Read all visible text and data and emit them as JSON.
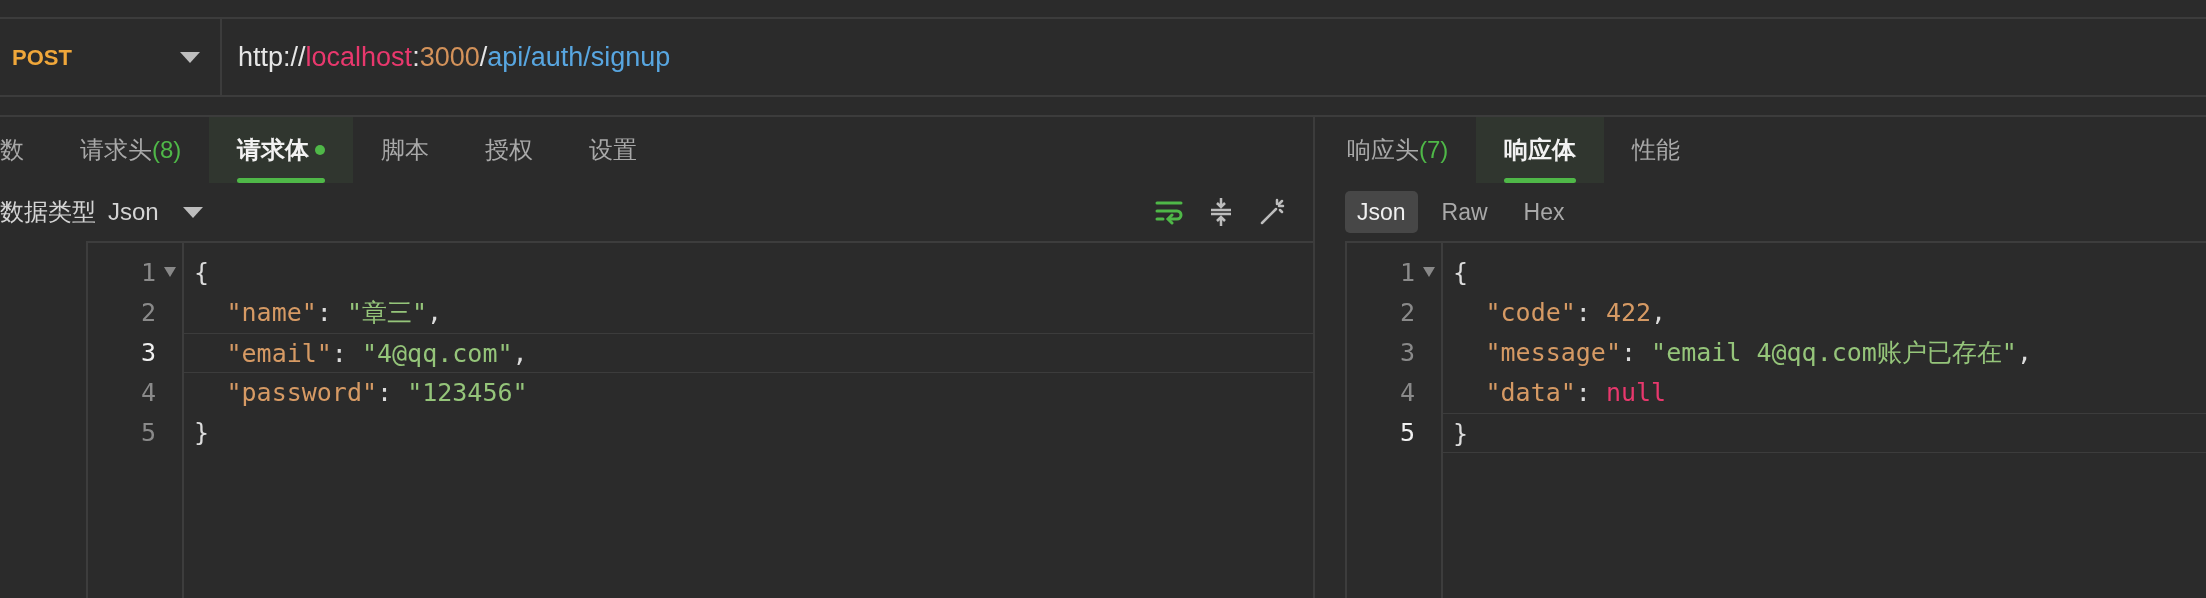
{
  "request": {
    "method": "POST",
    "url": [
      {
        "kind": "scheme",
        "text": "http://"
      },
      {
        "kind": "host",
        "text": "localhost"
      },
      {
        "kind": "punct",
        "text": ":"
      },
      {
        "kind": "port",
        "text": "3000"
      },
      {
        "kind": "punct",
        "text": "/"
      },
      {
        "kind": "path",
        "text": "api/auth/signup"
      }
    ]
  },
  "request_tabs": [
    {
      "label": "数",
      "selected": false
    },
    {
      "label": "请求头",
      "count": "(8)",
      "selected": false
    },
    {
      "label": "请求体",
      "selected": true,
      "dot": true
    },
    {
      "label": "脚本",
      "selected": false
    },
    {
      "label": "授权",
      "selected": false
    },
    {
      "label": "设置",
      "selected": false
    }
  ],
  "body_type": {
    "label": "数据类型",
    "value": "Json"
  },
  "request_editor": {
    "lines": [
      {
        "number": "1",
        "current": false,
        "tokens": [
          {
            "kind": "punct",
            "text": "{"
          }
        ]
      },
      {
        "number": "2",
        "current": false,
        "tokens": [
          {
            "kind": "key",
            "text": "\"name\""
          },
          {
            "kind": "punct",
            "text": ": "
          },
          {
            "kind": "string",
            "text": "\"章三\""
          },
          {
            "kind": "punct",
            "text": ","
          }
        ]
      },
      {
        "number": "3",
        "current": true,
        "tokens": [
          {
            "kind": "key",
            "text": "\"email\""
          },
          {
            "kind": "punct",
            "text": ": "
          },
          {
            "kind": "string",
            "text": "\"4@qq.com\""
          },
          {
            "kind": "punct",
            "text": ","
          }
        ]
      },
      {
        "number": "4",
        "current": false,
        "tokens": [
          {
            "kind": "key",
            "text": "\"password\""
          },
          {
            "kind": "punct",
            "text": ": "
          },
          {
            "kind": "string",
            "text": "\"123456\""
          }
        ]
      },
      {
        "number": "5",
        "current": false,
        "tokens": [
          {
            "kind": "punct",
            "text": "}"
          }
        ]
      }
    ]
  },
  "response_tabs": [
    {
      "label": "响应头",
      "count": "(7)",
      "selected": false
    },
    {
      "label": "响应体",
      "selected": true
    },
    {
      "label": "性能",
      "selected": false
    }
  ],
  "response_formats": [
    {
      "label": "Json",
      "selected": true
    },
    {
      "label": "Raw",
      "selected": false
    },
    {
      "label": "Hex",
      "selected": false
    }
  ],
  "response_editor": {
    "lines": [
      {
        "number": "1",
        "current": false,
        "tokens": [
          {
            "kind": "punct",
            "text": "{"
          }
        ]
      },
      {
        "number": "2",
        "current": false,
        "tokens": [
          {
            "kind": "key",
            "text": "\"code\""
          },
          {
            "kind": "punct",
            "text": ": "
          },
          {
            "kind": "number",
            "text": "422"
          },
          {
            "kind": "punct",
            "text": ","
          }
        ]
      },
      {
        "number": "3",
        "current": false,
        "tokens": [
          {
            "kind": "key",
            "text": "\"message\""
          },
          {
            "kind": "punct",
            "text": ": "
          },
          {
            "kind": "string",
            "text": "\"email 4@qq.com账户已存在\""
          },
          {
            "kind": "punct",
            "text": ","
          }
        ]
      },
      {
        "number": "4",
        "current": false,
        "tokens": [
          {
            "kind": "key",
            "text": "\"data\""
          },
          {
            "kind": "punct",
            "text": ": "
          },
          {
            "kind": "null",
            "text": "null"
          }
        ]
      },
      {
        "number": "5",
        "current": true,
        "tokens": [
          {
            "kind": "punct",
            "text": "}"
          }
        ]
      }
    ]
  }
}
